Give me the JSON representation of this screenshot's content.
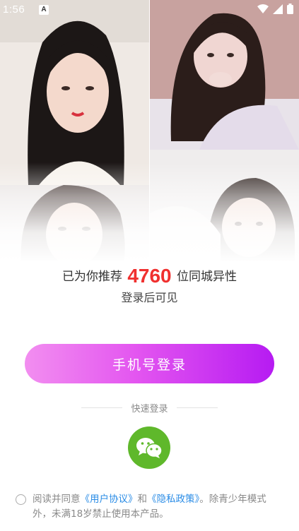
{
  "status_bar": {
    "time": "1:56",
    "notification_icon": "A"
  },
  "photos": [
    {
      "name": "photo-1",
      "palette": [
        "#f1ece8",
        "#1c1716",
        "#f3d6c8"
      ]
    },
    {
      "name": "photo-2",
      "palette": [
        "#c9a3a0",
        "#2b1d1a",
        "#ead1d0"
      ]
    },
    {
      "name": "photo-3",
      "palette": [
        "#e8e3e2",
        "#3a2b28",
        "#f2dad0"
      ]
    },
    {
      "name": "photo-4",
      "palette": [
        "#eeecec",
        "#2f2320",
        "#f1ddd4"
      ]
    }
  ],
  "recommend": {
    "prefix": "已为你推荐",
    "count": "4760",
    "suffix": "位同城异性",
    "visible_after_login": "登录后可见"
  },
  "phone_login_button": "手机号登录",
  "quick_login_label": "快速登录",
  "wechat_icon": "wechat-icon",
  "agreement": {
    "prefix": "阅读并同意",
    "user_agreement": "《用户协议》",
    "and": "和",
    "privacy_policy": "《隐私政策》",
    "suffix_line1": "。除青少年模式",
    "line2": "外，未满18岁禁止使用本产品。"
  },
  "colors": {
    "accent_count": "#f0302f",
    "button_gradient_start": "#f28ef0",
    "button_gradient_end": "#b61bf2",
    "wechat_green": "#5fb82b",
    "link_blue": "#2a8ce6"
  }
}
